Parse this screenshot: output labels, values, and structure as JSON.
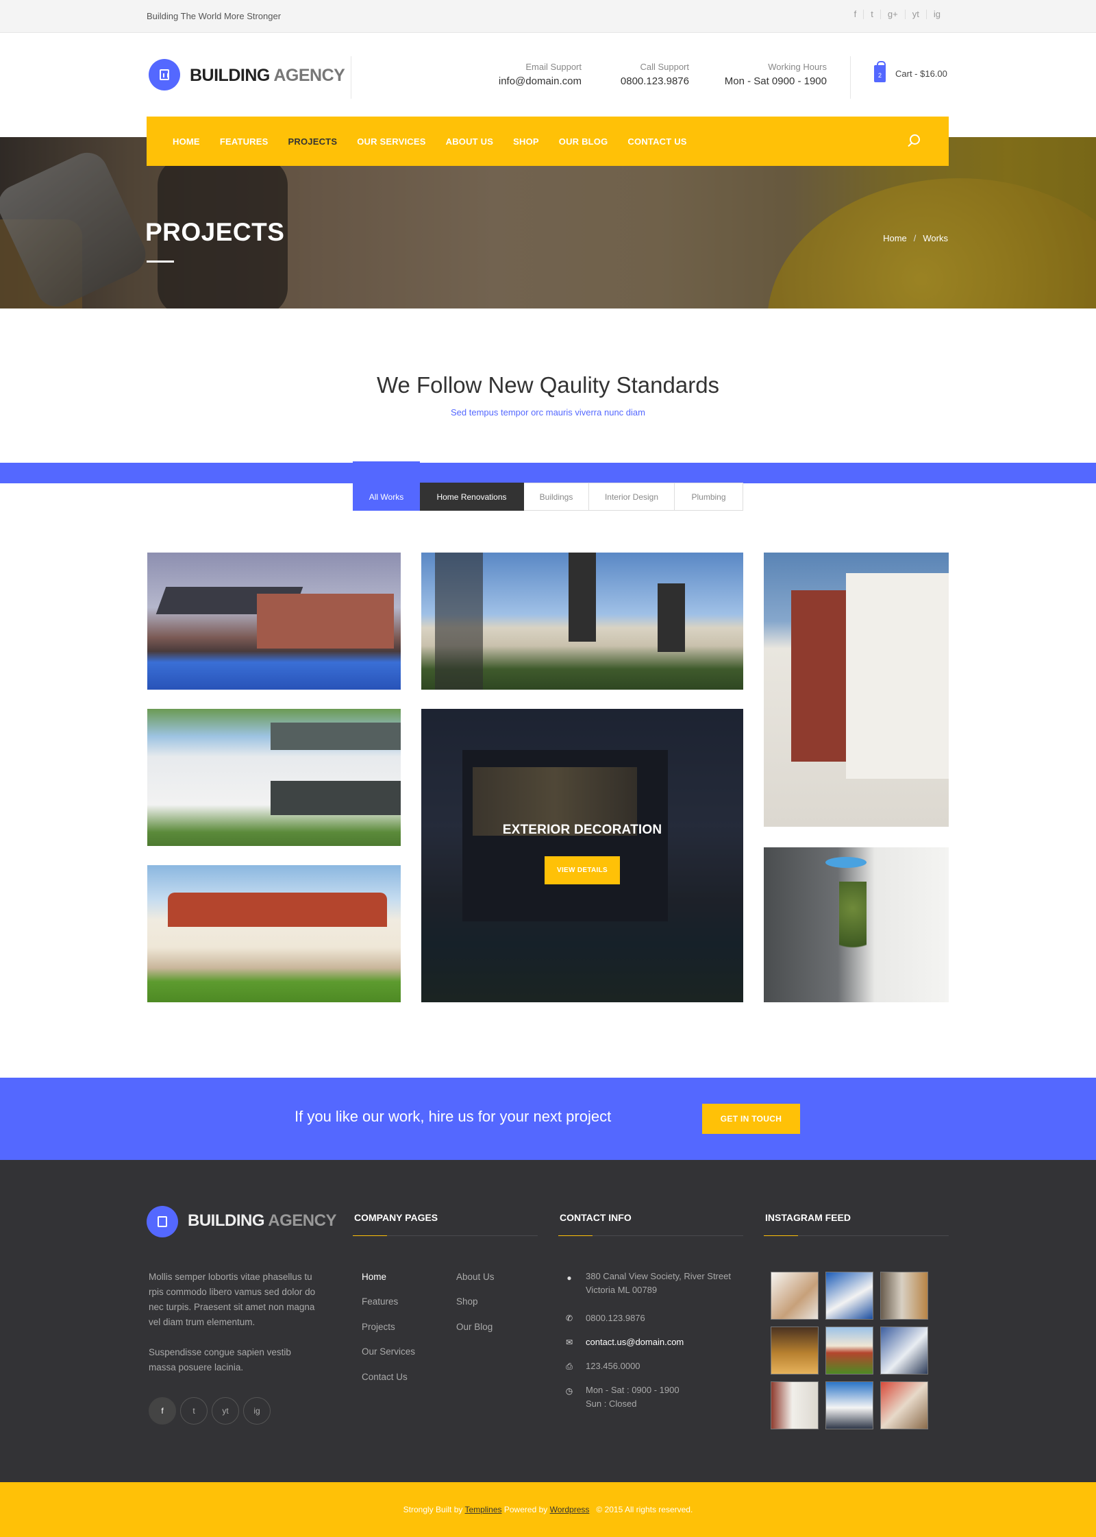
{
  "topbar": {
    "tagline": "Building The World More Stronger",
    "socials": [
      "f",
      "t",
      "g+",
      "yt",
      "ig"
    ]
  },
  "header": {
    "logo_bold": "BUILDING",
    "logo_light": "AGENCY",
    "email_label": "Email Support",
    "email_value": "info@domain.com",
    "call_label": "Call Support",
    "call_value": "0800.123.9876",
    "hours_label": "Working Hours",
    "hours_value": "Mon - Sat 0900 - 1900",
    "cart_count": "2",
    "cart_label": "Cart - $16.00"
  },
  "nav": {
    "items": [
      "HOME",
      "FEATURES",
      "PROJECTS",
      "OUR SERVICES",
      "ABOUT US",
      "SHOP",
      "OUR BLOG",
      "CONTACT US"
    ],
    "active": "PROJECTS"
  },
  "hero": {
    "title": "PROJECTS",
    "breadcrumb": [
      "Home",
      "Works"
    ]
  },
  "section": {
    "title": "We Follow New Qaulity Standards",
    "subtitle": "Sed tempus tempor orc mauris viverra nunc diam"
  },
  "filters": [
    "All Works",
    "Home Renovations",
    "Buildings",
    "Interior Design",
    "Plumbing"
  ],
  "gallery": {
    "overlay_title": "EXTERIOR DECORATION",
    "overlay_button": "VIEW DETAILS"
  },
  "cta": {
    "text": "If you like our work, hire us for your next project",
    "button": "GET IN TOUCH"
  },
  "footer": {
    "logo_bold": "BUILDING",
    "logo_light": "AGENCY",
    "about_p1": "Mollis semper lobortis vitae phasellus tu rpis commodo libero vamus sed dolor do nec turpis. Praesent sit amet non magna vel diam trum elementum.",
    "about_p2": "Suspendisse congue sapien vestib massa posuere lacinia.",
    "social": [
      "f",
      "t",
      "yt",
      "ig"
    ],
    "company_heading": "COMPANY PAGES",
    "company_col1": [
      "Home",
      "Features",
      "Projects",
      "Our Services",
      "Contact Us"
    ],
    "company_col2": [
      "About Us",
      "Shop",
      "Our Blog"
    ],
    "contact_heading": "CONTACT INFO",
    "address_line1": "380 Canal View Society, River Street",
    "address_line2": "Victoria ML 00789",
    "phone": "0800.123.9876",
    "email": "contact.us@domain.com",
    "fax": "123.456.0000",
    "hours_line1": "Mon - Sat : 0900 - 1900",
    "hours_line2": "Sun : Closed",
    "instagram_heading": "INSTAGRAM FEED"
  },
  "bottom": {
    "prefix": "Strongly Built by",
    "author": "Templines",
    "middle": "Powered by",
    "platform": "Wordpress",
    "rights": "© 2015 All rights reserved."
  }
}
